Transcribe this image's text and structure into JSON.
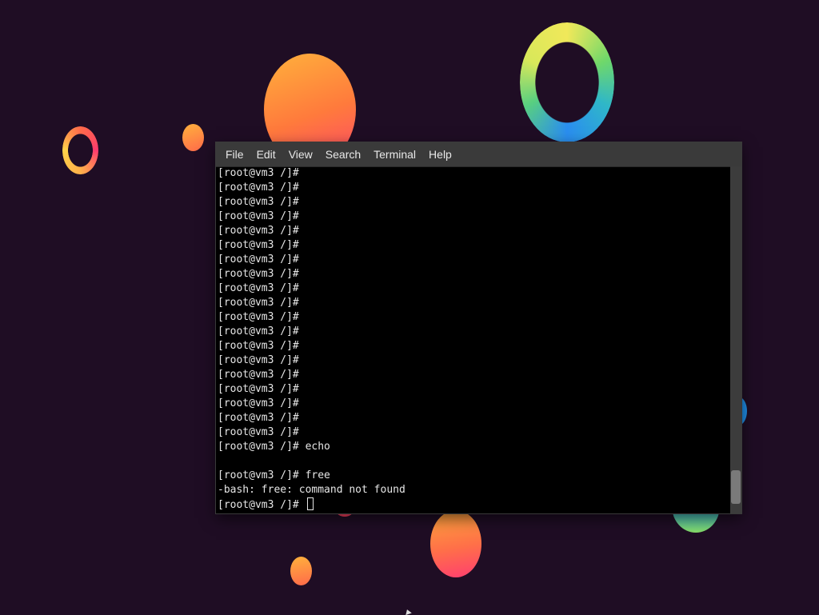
{
  "terminal": {
    "menu": [
      "File",
      "Edit",
      "View",
      "Search",
      "Terminal",
      "Help"
    ],
    "lines": [
      "[root@vm3 /]#",
      "[root@vm3 /]#",
      "[root@vm3 /]#",
      "[root@vm3 /]#",
      "[root@vm3 /]#",
      "[root@vm3 /]#",
      "[root@vm3 /]#",
      "[root@vm3 /]#",
      "[root@vm3 /]#",
      "[root@vm3 /]#",
      "[root@vm3 /]#",
      "[root@vm3 /]#",
      "[root@vm3 /]#",
      "[root@vm3 /]#",
      "[root@vm3 /]#",
      "[root@vm3 /]#",
      "[root@vm3 /]#",
      "[root@vm3 /]#",
      "[root@vm3 /]#",
      "[root@vm3 /]# echo",
      "",
      "[root@vm3 /]# free",
      "-bash: free: command not found"
    ],
    "prompt": "[root@vm3 /]#"
  },
  "icons": {
    "cursor": "text-cursor-icon",
    "pointer": "mouse-pointer-icon"
  }
}
